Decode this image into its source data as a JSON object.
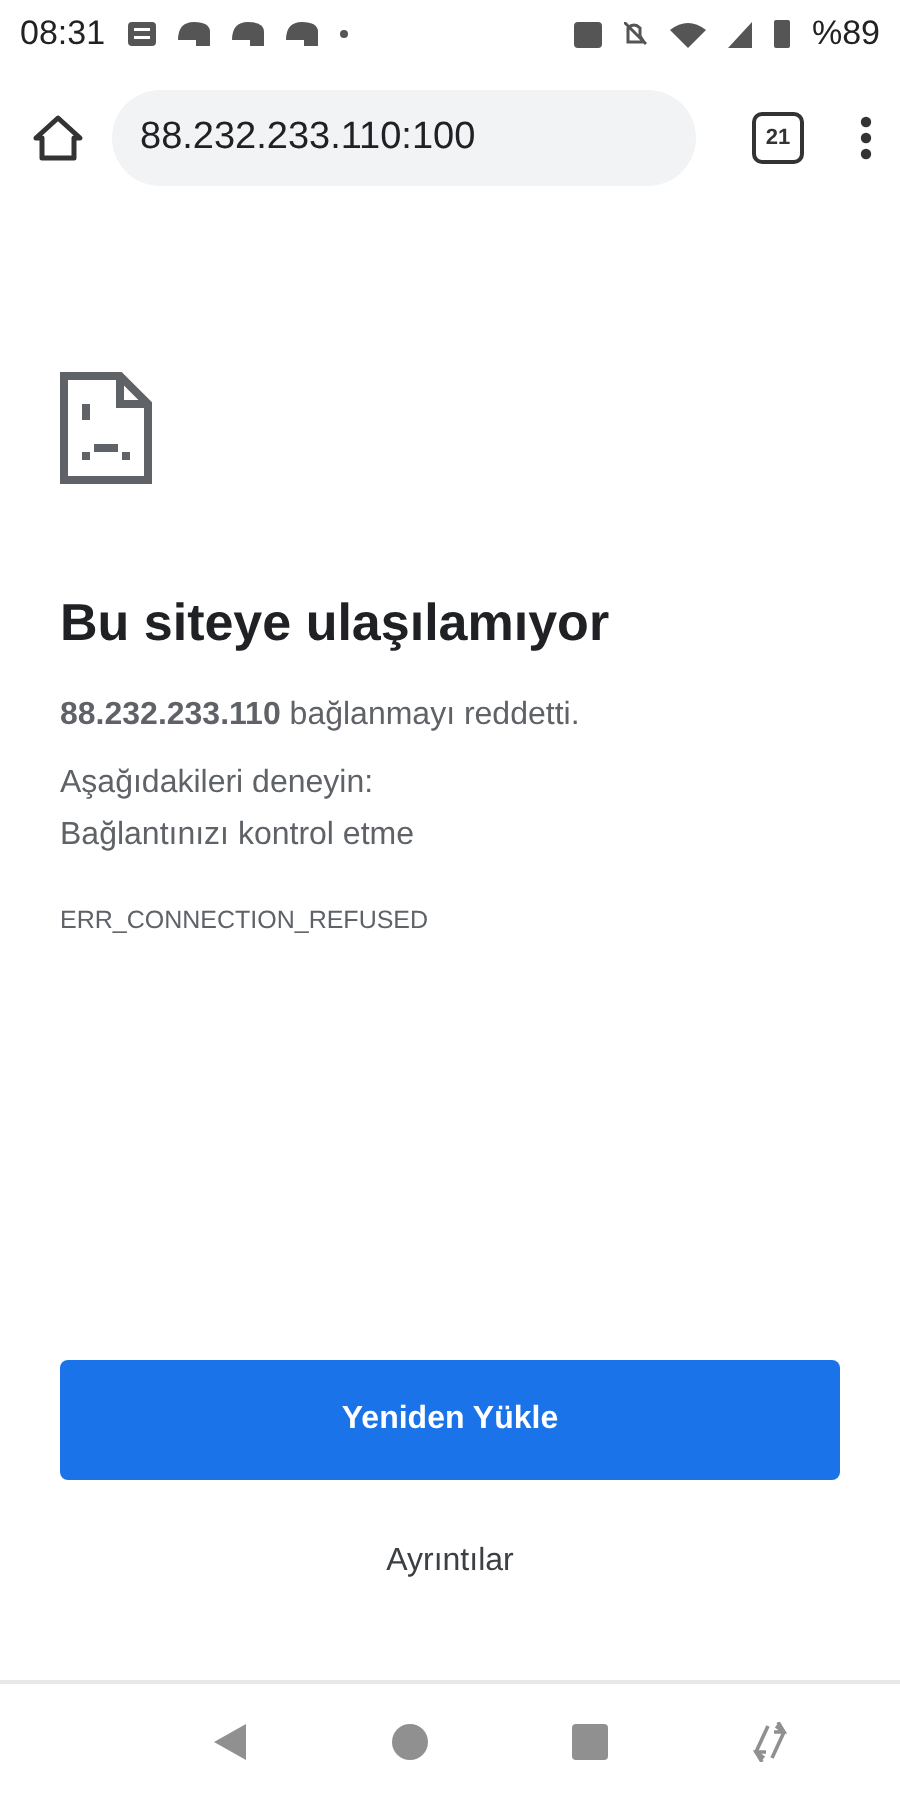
{
  "status_bar": {
    "time": "08:31",
    "battery": "%89"
  },
  "toolbar": {
    "url": "88.232.233.110:100",
    "tab_count": "21"
  },
  "error": {
    "heading": "Bu siteye ulaşılamıyor",
    "message": "**88.232.233.110** bağlanmayı reddetti.",
    "suggestions_title": "Aşağıdakileri deneyin:",
    "suggestions": [
      "Bağlantınızı kontrol etme"
    ],
    "code": "ERR_CONNECTION_REFUSED"
  },
  "actions": {
    "primary": "Yeniden Yükle",
    "secondary": "Ayrıntılar"
  }
}
